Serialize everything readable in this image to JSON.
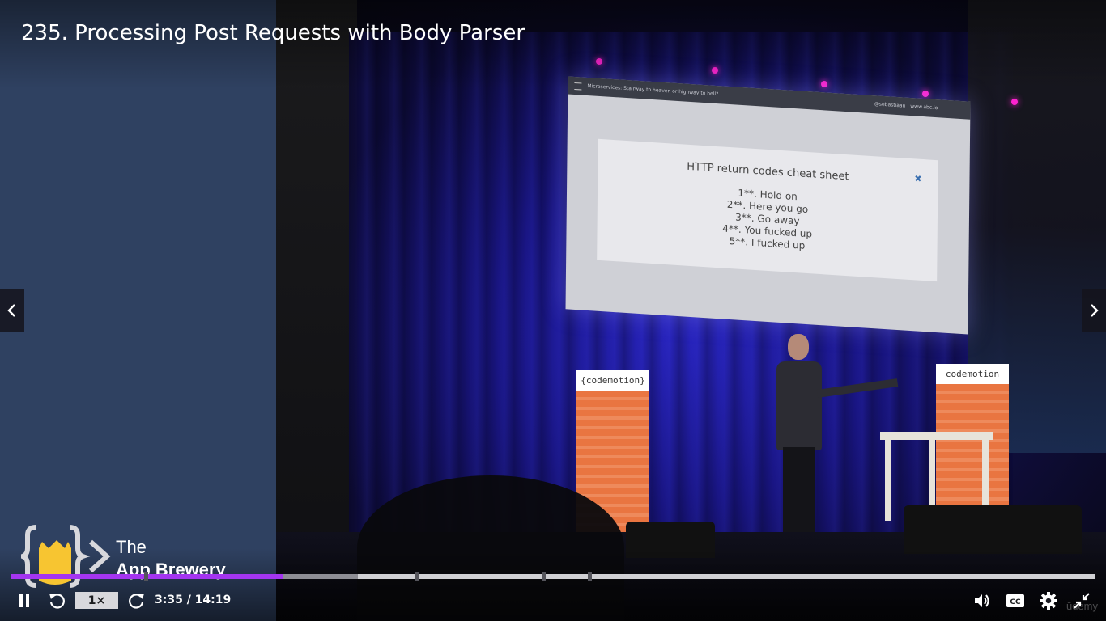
{
  "lecture": {
    "title": "235. Processing Post Requests with Body Parser"
  },
  "video_scene": {
    "screen_topbar": "Microservices: Stairway to heaven or highway to hell?",
    "screen_topbar_right": "@sebastiaan | www.abc.io",
    "card_title": "HTTP return codes cheat sheet",
    "card_lines": [
      "1**. Hold on",
      "2**. Here you go",
      "3**. Go away",
      "4**. You fucked up",
      "5**. I fucked up"
    ],
    "banner_label": "{codemotion}",
    "banner_label_right": "codemotion"
  },
  "logo": {
    "line1": "The",
    "line2": "App Brewery"
  },
  "watermark": "ūdemy",
  "player": {
    "current_time": "3:35",
    "duration": "14:19",
    "time_display": "3:35 / 14:19",
    "playback_speed": "1×",
    "progress_fraction": 0.25,
    "buffered_fraction": 0.32,
    "accent_color": "#a435f0",
    "state": "playing"
  },
  "icons": {
    "prev": "chevron-left-icon",
    "next": "chevron-right-icon",
    "pause": "pause-icon",
    "rewind": "rewind-5-icon",
    "forward": "forward-5-icon",
    "volume": "volume-icon",
    "captions": "captions-icon",
    "settings": "gear-icon",
    "exit_fullscreen": "exit-fullscreen-icon"
  }
}
